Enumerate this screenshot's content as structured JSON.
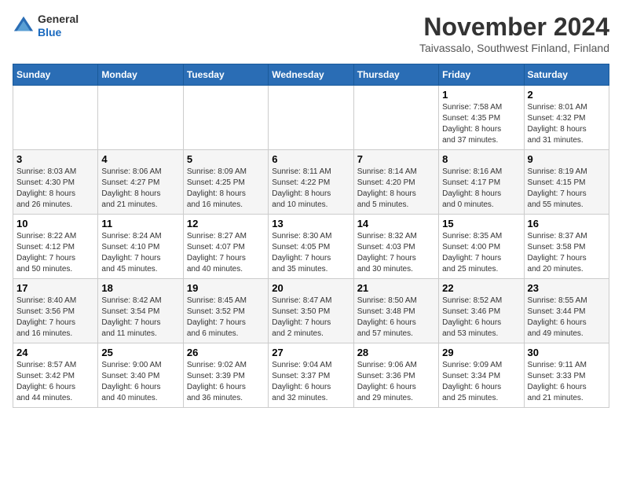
{
  "header": {
    "logo_line1": "General",
    "logo_line2": "Blue",
    "month_title": "November 2024",
    "location": "Taivassalo, Southwest Finland, Finland"
  },
  "calendar": {
    "days_of_week": [
      "Sunday",
      "Monday",
      "Tuesday",
      "Wednesday",
      "Thursday",
      "Friday",
      "Saturday"
    ],
    "weeks": [
      [
        {
          "day": "",
          "info": ""
        },
        {
          "day": "",
          "info": ""
        },
        {
          "day": "",
          "info": ""
        },
        {
          "day": "",
          "info": ""
        },
        {
          "day": "",
          "info": ""
        },
        {
          "day": "1",
          "info": "Sunrise: 7:58 AM\nSunset: 4:35 PM\nDaylight: 8 hours\nand 37 minutes."
        },
        {
          "day": "2",
          "info": "Sunrise: 8:01 AM\nSunset: 4:32 PM\nDaylight: 8 hours\nand 31 minutes."
        }
      ],
      [
        {
          "day": "3",
          "info": "Sunrise: 8:03 AM\nSunset: 4:30 PM\nDaylight: 8 hours\nand 26 minutes."
        },
        {
          "day": "4",
          "info": "Sunrise: 8:06 AM\nSunset: 4:27 PM\nDaylight: 8 hours\nand 21 minutes."
        },
        {
          "day": "5",
          "info": "Sunrise: 8:09 AM\nSunset: 4:25 PM\nDaylight: 8 hours\nand 16 minutes."
        },
        {
          "day": "6",
          "info": "Sunrise: 8:11 AM\nSunset: 4:22 PM\nDaylight: 8 hours\nand 10 minutes."
        },
        {
          "day": "7",
          "info": "Sunrise: 8:14 AM\nSunset: 4:20 PM\nDaylight: 8 hours\nand 5 minutes."
        },
        {
          "day": "8",
          "info": "Sunrise: 8:16 AM\nSunset: 4:17 PM\nDaylight: 8 hours\nand 0 minutes."
        },
        {
          "day": "9",
          "info": "Sunrise: 8:19 AM\nSunset: 4:15 PM\nDaylight: 7 hours\nand 55 minutes."
        }
      ],
      [
        {
          "day": "10",
          "info": "Sunrise: 8:22 AM\nSunset: 4:12 PM\nDaylight: 7 hours\nand 50 minutes."
        },
        {
          "day": "11",
          "info": "Sunrise: 8:24 AM\nSunset: 4:10 PM\nDaylight: 7 hours\nand 45 minutes."
        },
        {
          "day": "12",
          "info": "Sunrise: 8:27 AM\nSunset: 4:07 PM\nDaylight: 7 hours\nand 40 minutes."
        },
        {
          "day": "13",
          "info": "Sunrise: 8:30 AM\nSunset: 4:05 PM\nDaylight: 7 hours\nand 35 minutes."
        },
        {
          "day": "14",
          "info": "Sunrise: 8:32 AM\nSunset: 4:03 PM\nDaylight: 7 hours\nand 30 minutes."
        },
        {
          "day": "15",
          "info": "Sunrise: 8:35 AM\nSunset: 4:00 PM\nDaylight: 7 hours\nand 25 minutes."
        },
        {
          "day": "16",
          "info": "Sunrise: 8:37 AM\nSunset: 3:58 PM\nDaylight: 7 hours\nand 20 minutes."
        }
      ],
      [
        {
          "day": "17",
          "info": "Sunrise: 8:40 AM\nSunset: 3:56 PM\nDaylight: 7 hours\nand 16 minutes."
        },
        {
          "day": "18",
          "info": "Sunrise: 8:42 AM\nSunset: 3:54 PM\nDaylight: 7 hours\nand 11 minutes."
        },
        {
          "day": "19",
          "info": "Sunrise: 8:45 AM\nSunset: 3:52 PM\nDaylight: 7 hours\nand 6 minutes."
        },
        {
          "day": "20",
          "info": "Sunrise: 8:47 AM\nSunset: 3:50 PM\nDaylight: 7 hours\nand 2 minutes."
        },
        {
          "day": "21",
          "info": "Sunrise: 8:50 AM\nSunset: 3:48 PM\nDaylight: 6 hours\nand 57 minutes."
        },
        {
          "day": "22",
          "info": "Sunrise: 8:52 AM\nSunset: 3:46 PM\nDaylight: 6 hours\nand 53 minutes."
        },
        {
          "day": "23",
          "info": "Sunrise: 8:55 AM\nSunset: 3:44 PM\nDaylight: 6 hours\nand 49 minutes."
        }
      ],
      [
        {
          "day": "24",
          "info": "Sunrise: 8:57 AM\nSunset: 3:42 PM\nDaylight: 6 hours\nand 44 minutes."
        },
        {
          "day": "25",
          "info": "Sunrise: 9:00 AM\nSunset: 3:40 PM\nDaylight: 6 hours\nand 40 minutes."
        },
        {
          "day": "26",
          "info": "Sunrise: 9:02 AM\nSunset: 3:39 PM\nDaylight: 6 hours\nand 36 minutes."
        },
        {
          "day": "27",
          "info": "Sunrise: 9:04 AM\nSunset: 3:37 PM\nDaylight: 6 hours\nand 32 minutes."
        },
        {
          "day": "28",
          "info": "Sunrise: 9:06 AM\nSunset: 3:36 PM\nDaylight: 6 hours\nand 29 minutes."
        },
        {
          "day": "29",
          "info": "Sunrise: 9:09 AM\nSunset: 3:34 PM\nDaylight: 6 hours\nand 25 minutes."
        },
        {
          "day": "30",
          "info": "Sunrise: 9:11 AM\nSunset: 3:33 PM\nDaylight: 6 hours\nand 21 minutes."
        }
      ]
    ]
  }
}
